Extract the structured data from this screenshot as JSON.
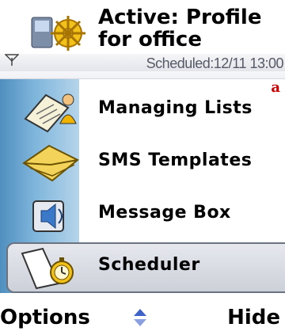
{
  "header": {
    "title_line1": "Active: Profile",
    "title_line2": "for office",
    "status": "Scheduled:12/11 13:00",
    "icon": "profile-wheel-icon"
  },
  "list": {
    "corner_mark": "a",
    "items": [
      {
        "label": "Managing Lists",
        "icon": "notebook-person-icon",
        "selected": false
      },
      {
        "label": "SMS Templates",
        "icon": "envelopes-icon",
        "selected": false
      },
      {
        "label": "Message Box",
        "icon": "speaker-box-icon",
        "selected": false
      },
      {
        "label": "Scheduler",
        "icon": "stopwatch-icon",
        "selected": true
      }
    ]
  },
  "softkeys": {
    "left": "Options",
    "right": "Hide",
    "middle_icon": "up-down-arrows-icon"
  },
  "colors": {
    "panel_dark": "#4f8fbf",
    "panel_light": "#b5d4ea",
    "accent_red": "#cc0000"
  }
}
